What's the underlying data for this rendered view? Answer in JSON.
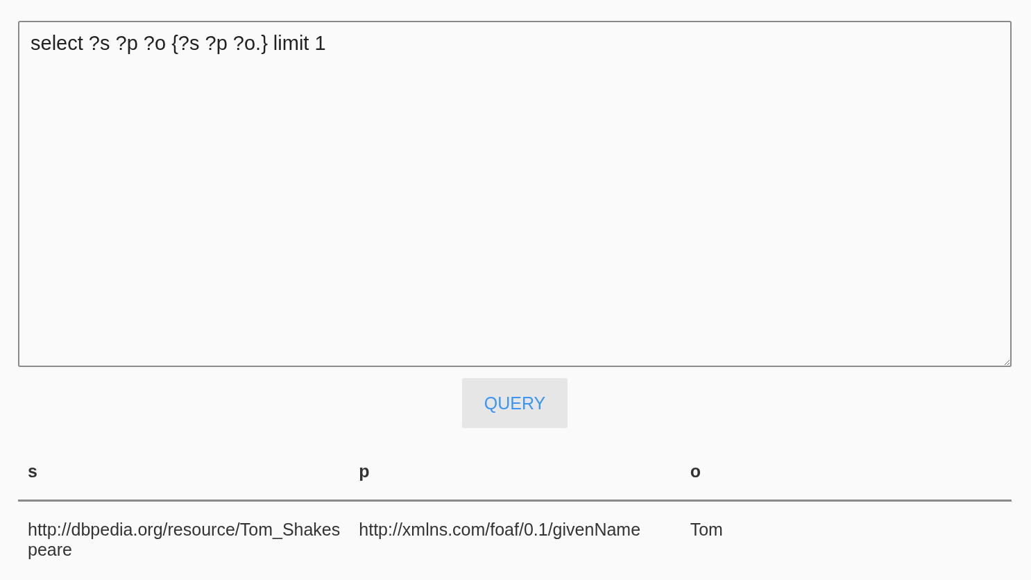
{
  "query": {
    "value": "select ?s ?p ?o {?s ?p ?o.} limit 1"
  },
  "button": {
    "label": "QUERY"
  },
  "table": {
    "columns": [
      "s",
      "p",
      "o"
    ],
    "rows": [
      [
        "http://dbpedia.org/resource/Tom_Shakespeare",
        "http://xmlns.com/foaf/0.1/givenName",
        "Tom"
      ]
    ]
  }
}
